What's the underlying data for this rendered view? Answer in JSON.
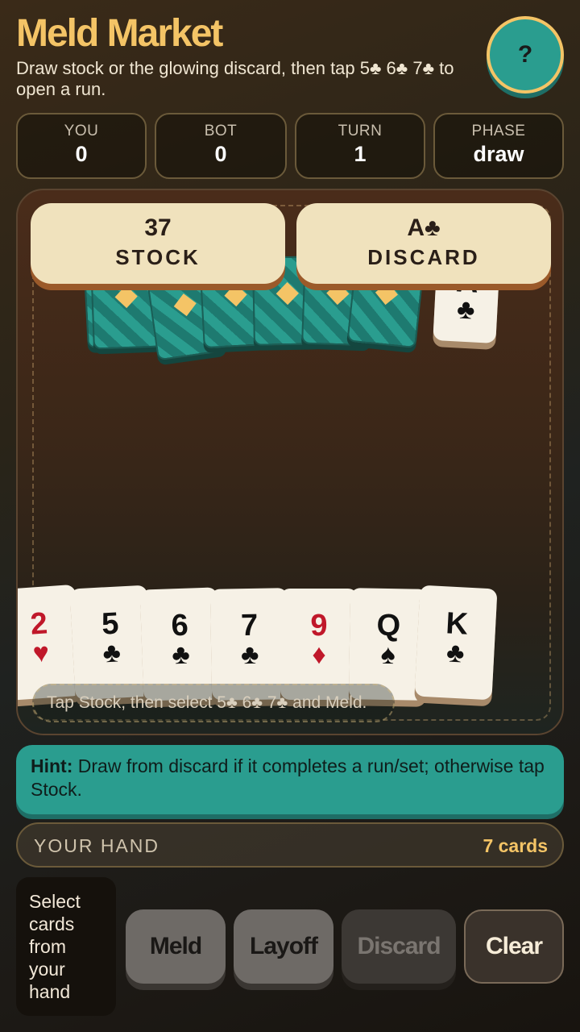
{
  "header": {
    "title": "Meld Market",
    "subtitle": "Draw stock or the glowing discard, then tap 5♣ 6♣ 7♣ to open a run.",
    "help_label": "?"
  },
  "stats": [
    {
      "label": "YOU",
      "value": "0"
    },
    {
      "label": "BOT",
      "value": "0"
    },
    {
      "label": "TURN",
      "value": "1"
    },
    {
      "label": "PHASE",
      "value": "draw"
    }
  ],
  "piles": {
    "stock_count": "37",
    "stock_label": "STOCK",
    "discard_top": "A♣",
    "discard_label": "DISCARD",
    "discard_card": {
      "rank": "A",
      "suit": "♣"
    }
  },
  "hand": [
    {
      "rank": "2",
      "suit": "♥",
      "color": "#c0182a"
    },
    {
      "rank": "5",
      "suit": "♣",
      "color": "#111111"
    },
    {
      "rank": "6",
      "suit": "♣",
      "color": "#111111"
    },
    {
      "rank": "7",
      "suit": "♣",
      "color": "#111111"
    },
    {
      "rank": "9",
      "suit": "♦",
      "color": "#c0182a"
    },
    {
      "rank": "Q",
      "suit": "♠",
      "color": "#111111"
    },
    {
      "rank": "K",
      "suit": "♣",
      "color": "#111111"
    }
  ],
  "table_instruction": "Tap Stock, then select 5♣ 6♣ 7♣ and Meld.",
  "hint": {
    "bold": "Hint:",
    "text": " Draw from discard if it completes a run/set; otherwise tap Stock."
  },
  "hand_bar": {
    "label": "YOUR HAND",
    "count": "7 cards"
  },
  "select_prompt": "Select cards from your hand",
  "actions": {
    "meld": "Meld",
    "layoff": "Layoff",
    "discard": "Discard",
    "clear": "Clear"
  },
  "colors": {
    "accent_gold": "#f4c466",
    "teal": "#2a9d8f",
    "card_face": "#f6f1e6",
    "red_suit": "#c0182a"
  }
}
